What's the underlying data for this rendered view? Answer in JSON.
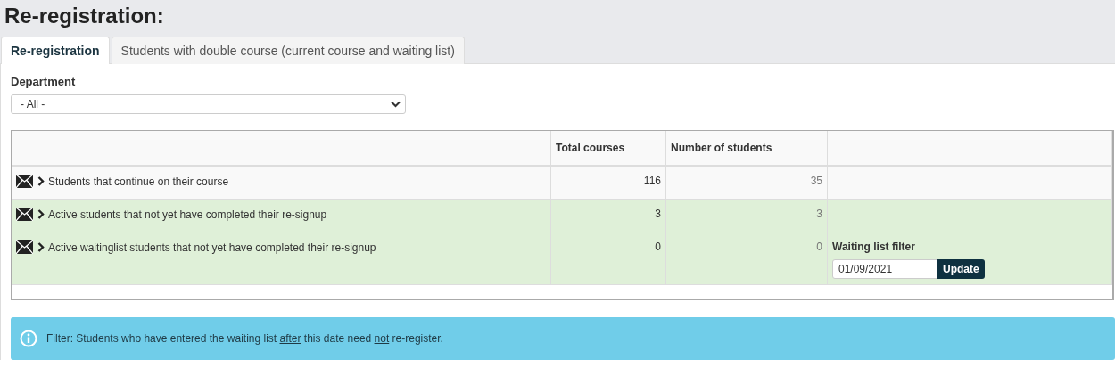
{
  "title": "Re-registration:",
  "tabs": [
    {
      "label": "Re-registration",
      "selected": true
    },
    {
      "label": "Students with double course (current course and waiting list)",
      "selected": false
    }
  ],
  "department": {
    "label": "Department",
    "value": "- All -"
  },
  "table": {
    "columns": [
      "Total courses",
      "Number of students"
    ],
    "rows": [
      {
        "label": "Students that continue on their course",
        "total_courses": "116",
        "number_of_students": "35",
        "highlighted": false
      },
      {
        "label": "Active students that not yet have completed their re-signup",
        "total_courses": "3",
        "number_of_students": "3",
        "highlighted": true
      },
      {
        "label": "Active waitinglist students that not yet have completed their re-signup",
        "total_courses": "0",
        "number_of_students": "0",
        "highlighted": true,
        "filter": {
          "label": "Waiting list filter",
          "value": "01/09/2021",
          "button": "Update"
        }
      }
    ]
  },
  "info": {
    "parts": [
      {
        "text": "Filter: Students who have entered the waiting list ",
        "underline": false
      },
      {
        "text": "after",
        "underline": true
      },
      {
        "text": " this date need ",
        "underline": false
      },
      {
        "text": "not",
        "underline": true
      },
      {
        "text": " re-register.",
        "underline": false
      }
    ]
  }
}
